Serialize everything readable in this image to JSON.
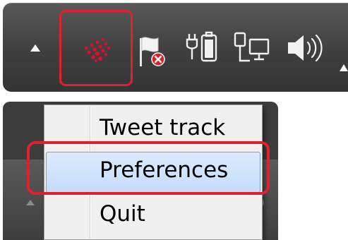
{
  "tray": {
    "icons": [
      "show-hidden-icons-arrow-icon",
      "tweet-tracker-dots-icon",
      "action-center-flag-error-icon",
      "power-battery-icon",
      "network-icon",
      "volume-speaker-icon"
    ],
    "highlighted_icon": "tweet-tracker-dots-icon"
  },
  "context_menu": {
    "items": [
      {
        "label": "Tweet track"
      },
      {
        "label": "Preferences",
        "highlighted": true
      },
      {
        "label": "Quit"
      }
    ]
  },
  "colors": {
    "tray_background": "#444444",
    "menu_background": "#f0f0f0",
    "menu_hover": "#cfe3fb",
    "annotation_red": "#e0202a",
    "tracker_icon_red": "#d8102c"
  }
}
